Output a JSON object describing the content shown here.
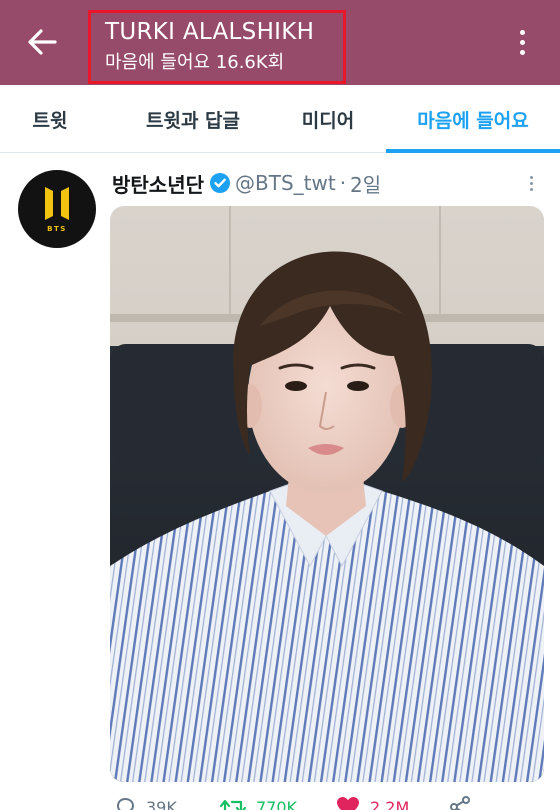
{
  "header": {
    "title": "TURKI ALALSHIKH",
    "subtitle": "마음에 들어요 16.6K회",
    "background_color": "#974b6a",
    "highlight_border_color": "#e8182a",
    "back_icon": "arrow-left-icon",
    "more_icon": "more-vertical-icon"
  },
  "tabs": [
    {
      "label": "트윗",
      "active": false
    },
    {
      "label": "트윗과 답글",
      "active": false
    },
    {
      "label": "미디어",
      "active": false
    },
    {
      "label": "마음에 들어요",
      "active": true
    }
  ],
  "accent_color": "#1da1f2",
  "tweet": {
    "author_name": "방탄소년단",
    "verified": true,
    "handle": "@BTS_twt",
    "separator": "·",
    "time": "2일",
    "avatar_logo_text": "BTS",
    "image_description_icon": "photo-attachment",
    "actions": {
      "reply": {
        "icon": "reply-icon",
        "count": "39K"
      },
      "retweet": {
        "icon": "retweet-icon",
        "count": "770K",
        "color": "#17bf63"
      },
      "like": {
        "icon": "heart-icon",
        "count": "2.2M",
        "color": "#e0245e"
      },
      "share": {
        "icon": "share-icon"
      }
    }
  }
}
